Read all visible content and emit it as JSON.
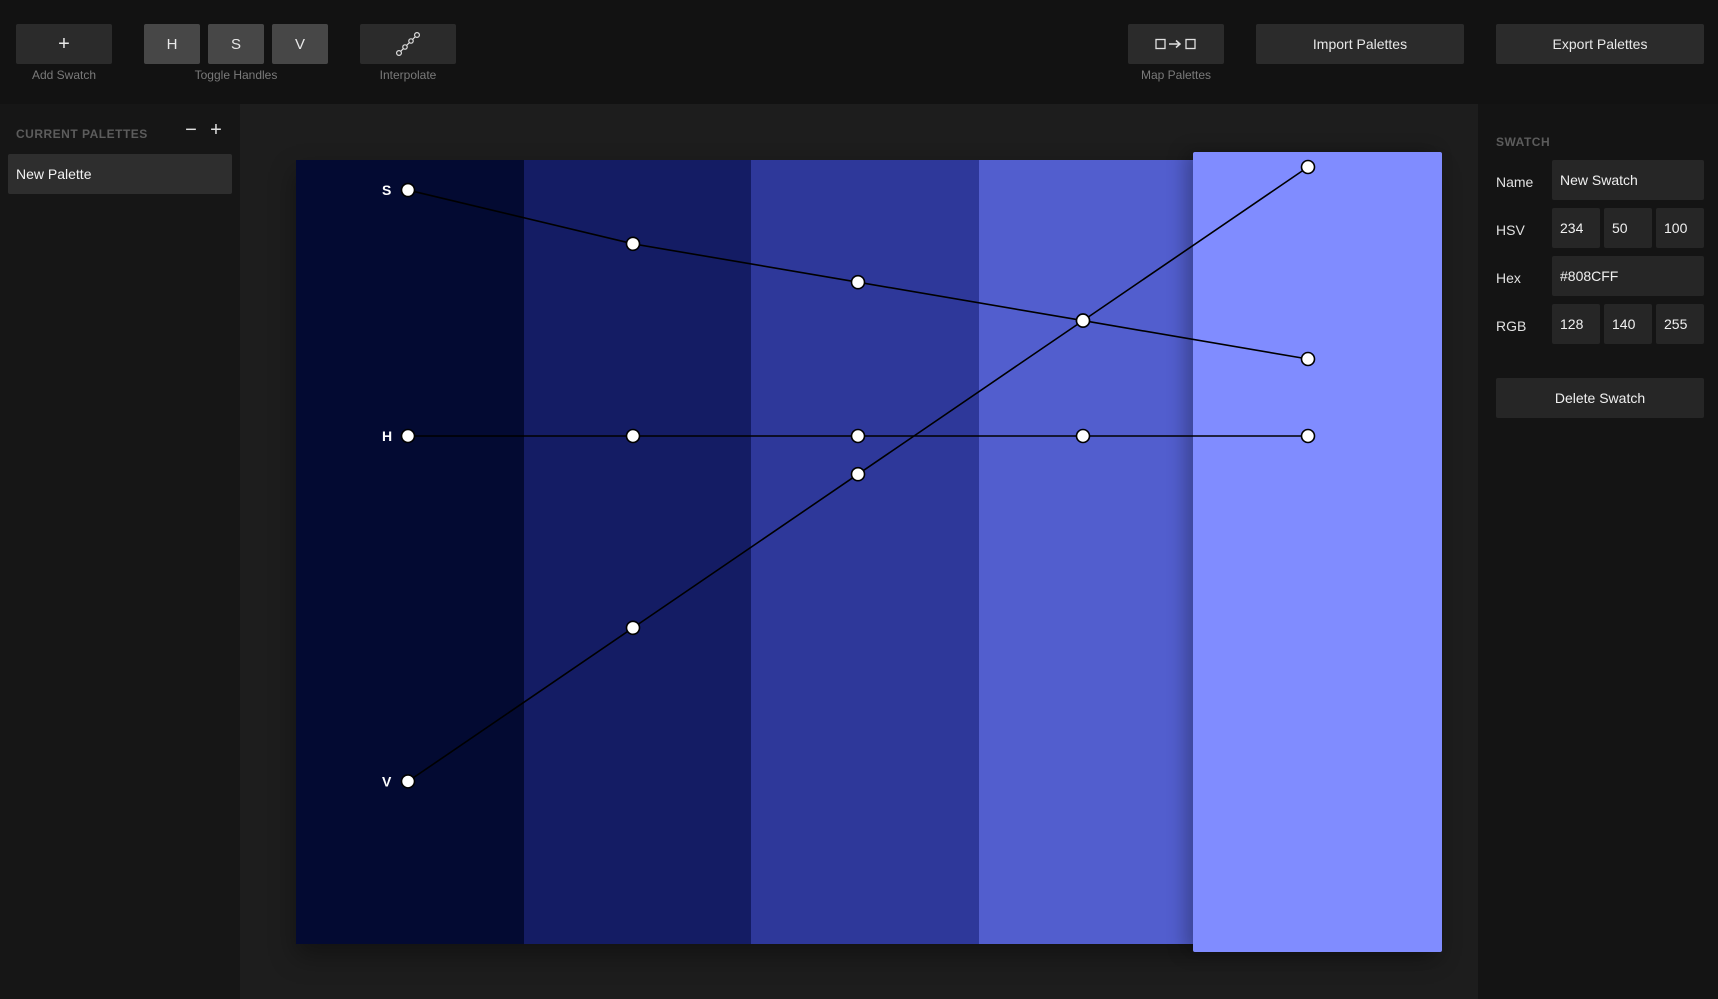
{
  "toolbar": {
    "add_swatch": {
      "icon": "+",
      "label": "Add Swatch"
    },
    "toggle_handles": {
      "buttons": [
        "H",
        "S",
        "V"
      ],
      "label": "Toggle Handles"
    },
    "interpolate": {
      "icon": "interpolate-icon",
      "label": "Interpolate"
    },
    "map_palettes": {
      "icon": "map-palettes-icon",
      "label": "Map Palettes"
    },
    "import_label": "Import Palettes",
    "export_label": "Export Palettes"
  },
  "sidebar": {
    "title": "CURRENT PALETTES",
    "remove_icon": "−",
    "add_icon": "+",
    "palettes": [
      {
        "name": "New Palette"
      }
    ]
  },
  "canvas": {
    "swatches": [
      {
        "hex": "#030A32",
        "h": 234,
        "s": 94,
        "v": 20
      },
      {
        "hex": "#141C64",
        "h": 234,
        "s": 80,
        "v": 40
      },
      {
        "hex": "#2E389A",
        "h": 234,
        "s": 70,
        "v": 60
      },
      {
        "hex": "#525ECE",
        "h": 234,
        "s": 60,
        "v": 80
      },
      {
        "hex": "#808CFF",
        "h": 234,
        "s": 50,
        "v": 100
      }
    ],
    "selected_index": 4,
    "handle_labels": {
      "h": "H",
      "s": "S",
      "v": "V"
    }
  },
  "panel": {
    "title": "SWATCH",
    "name_label": "Name",
    "name_value": "New Swatch",
    "hsv_label": "HSV",
    "hsv": [
      "234",
      "50",
      "100"
    ],
    "hex_label": "Hex",
    "hex_value": "#808CFF",
    "rgb_label": "RGB",
    "rgb": [
      "128",
      "140",
      "255"
    ],
    "delete_label": "Delete Swatch"
  }
}
